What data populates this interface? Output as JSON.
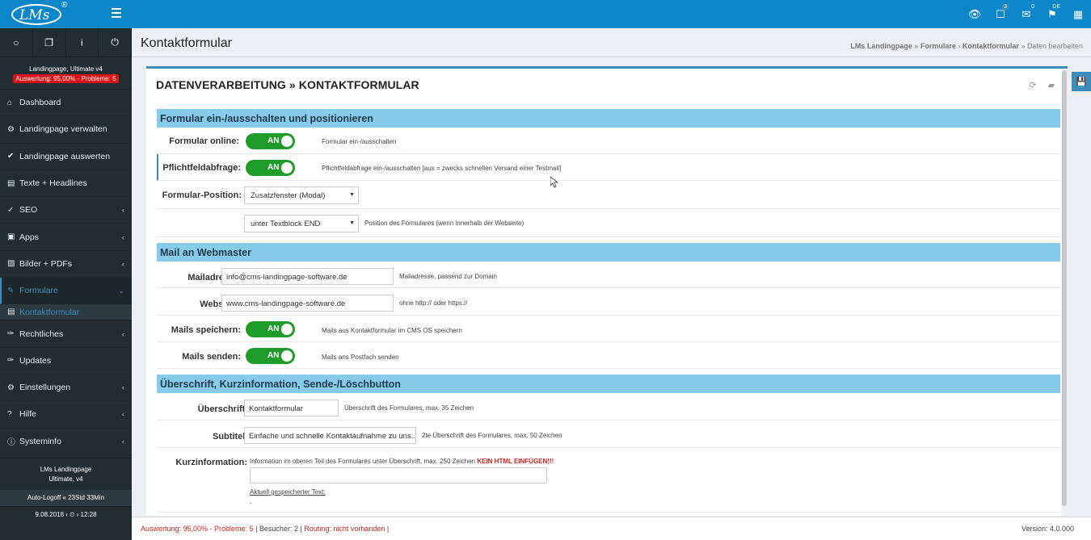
{
  "topbar": {
    "logo_text": "LMs",
    "logo_reg": "®",
    "badges": {
      "tasks": "3",
      "mail": "0",
      "lang": "DE"
    }
  },
  "sidebar": {
    "site_name": "Landingpage, Ultimate v4",
    "warning": "Auswertung: 95,00% - Probleme: 5",
    "items": [
      {
        "label": "Dashboard",
        "icon": "home-icon"
      },
      {
        "label": "Landingpage verwalten",
        "icon": "gear-icon"
      },
      {
        "label": "Landingpage auswerten",
        "icon": "check-circle-icon"
      },
      {
        "label": "Texte + Headlines",
        "icon": "document-icon"
      },
      {
        "label": "SEO",
        "icon": "check-icon"
      },
      {
        "label": "Apps",
        "icon": "cubes-icon"
      },
      {
        "label": "Bilder + PDFs",
        "icon": "image-icon"
      },
      {
        "label": "Formulare",
        "icon": "edit-icon"
      },
      {
        "label": "Kontaktformular",
        "icon": "document-icon"
      },
      {
        "label": "Rechtliches",
        "icon": "wrench-icon"
      },
      {
        "label": "Updates",
        "icon": "wrench-icon"
      },
      {
        "label": "Einstellungen",
        "icon": "gears-icon"
      },
      {
        "label": "Hilfe",
        "icon": "question-icon"
      },
      {
        "label": "Systeminfo",
        "icon": "info-icon"
      }
    ],
    "footer_line1": "LMs Landingpage",
    "footer_line2": "Ultimate, v4",
    "auto_logoff": "Auto-Logoff « 23Std 33Min",
    "date_time": "9.08.2018 ‹ ⏲ › 12:28"
  },
  "header": {
    "title": "Kontaktformular",
    "breadcrumb": [
      "LMs Landingpage",
      "Formulare",
      "Kontaktformular",
      "Daten bearbeiten"
    ]
  },
  "box": {
    "title": "DATENVERARBEITUNG » KONTAKTFORMULAR"
  },
  "sections": {
    "s1": "Formular ein-/ausschalten und positionieren",
    "s2": "Mail an Webmaster",
    "s3": "Überschrift, Kurzinformation, Sende-/Löschbutton"
  },
  "fields": {
    "online": {
      "label": "Formular online:",
      "toggle": "AN",
      "help": "Formular ein-/ausschalten"
    },
    "pflicht": {
      "label": "Pflichtfeldabfrage:",
      "toggle": "AN",
      "help": "Pflichtfeldabfrage ein-/ausschalten [aus = zwecks schnellen Versand einer Testmail]"
    },
    "position": {
      "label": "Formular-Position:",
      "value": "Zusatzfenster (Modal)"
    },
    "position2": {
      "value": "unter Textblock END",
      "help": "Position des Formulares (wenn innerhalb der Webseite)"
    },
    "mail": {
      "label": "Mailadresse:",
      "value": "info@cms-landingpage-software.de",
      "help": "Mailadresse, passend zur Domain"
    },
    "web": {
      "label": "Webseite:",
      "value": "www.cms-landingpage-software.de",
      "help": "ohne http:// oder https://"
    },
    "save_mails": {
      "label": "Mails speichern:",
      "toggle": "AN",
      "help": "Mails aus Kontaktformular im CMS OS speichern"
    },
    "send_mails": {
      "label": "Mails senden:",
      "toggle": "AN",
      "help": "Mails ans Postfach senden"
    },
    "headline": {
      "label": "Überschrift:",
      "value": "Kontaktformular",
      "help": "Überschrift des Formulares, max. 35 Zeichen"
    },
    "subtitle": {
      "label": "Subtitel:",
      "value": "Einfache und schnelle Kontaktaufnahme zu uns...",
      "help": "2te Überschrift des Formulares, max. 50 Zeichen"
    },
    "info": {
      "label": "Kurzinformation:",
      "help": "Information im oberen Teil des Formulares unter Überschrift, max. 250 Zeichen",
      "help_red": "KEIN HTML EINFÜGEN!!!",
      "saved_label": "Aktuell gespeicherter Text:",
      "saved_value": "-"
    }
  },
  "footer": {
    "auswertung": "Auswertung: 95,00% - Probleme: 5",
    "besucher": "Besucher: 2",
    "routing": "Routing: nicht vorhanden",
    "version": "Version: 4.0.000"
  }
}
